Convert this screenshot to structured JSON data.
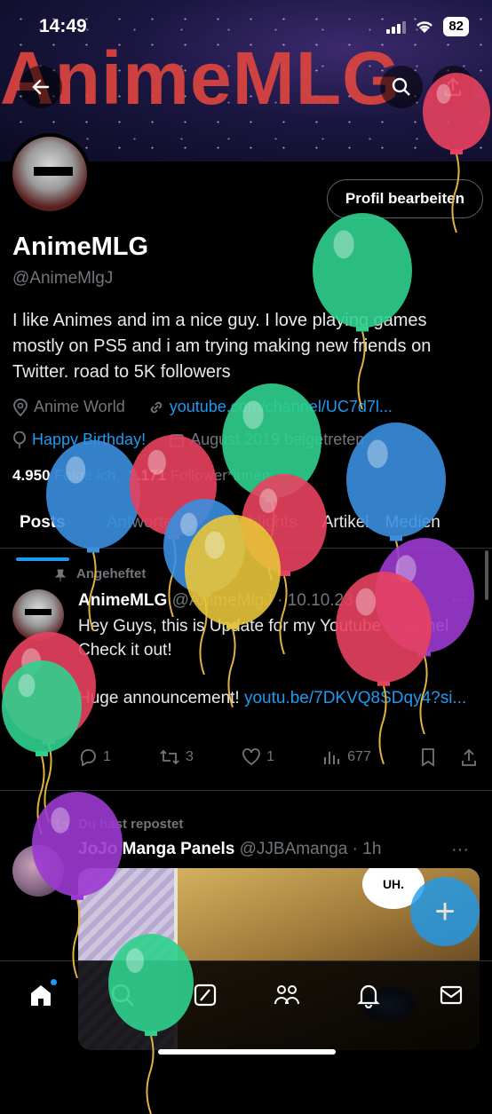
{
  "status_bar": {
    "time": "14:49",
    "battery": "82"
  },
  "banner": {
    "text": "AnimeMLG"
  },
  "profile": {
    "edit_button": "Profil bearbeiten",
    "name": "AnimeMLG",
    "handle": "@AnimeMlgJ",
    "bio": "I like Animes and im a nice guy. I love playing games mostly on PS5 and i am trying making new friends on Twitter. road to 5K followers",
    "location": "Anime World",
    "website": "youtube.com/channel/UC7d7l...",
    "birthday": "Happy Birthday!",
    "joined": "August 2019 beigetreten",
    "following_count": "4.950",
    "following_label": "Folge ich",
    "followers_count": "1.171",
    "followers_label": "Follower*innen"
  },
  "tabs": [
    "Posts",
    "Antworten",
    "Highlights",
    "Artikel",
    "Medien"
  ],
  "pinned_tweet": {
    "pinned_label": "Angeheftet",
    "author": "AnimeMLG",
    "handle": "@AnimeMlgJ",
    "date": "· 10.10.23",
    "text_1": "Hey Guys, this is Update for my Youtube Channel Check it out!",
    "text_2": "Huge announcement! ",
    "link": "youtu.be/7DKVQ8SDqy4?si...",
    "replies": "1",
    "retweets": "3",
    "likes": "1",
    "views": "677"
  },
  "repost": {
    "label": "Du hast repostet",
    "author": "JoJo Manga Panels",
    "handle": "@JJBAmanga",
    "time": "· 1h",
    "bubble_text": "UH."
  },
  "icons": {
    "back": "arrow-left-icon",
    "search": "search-icon",
    "share": "share-icon",
    "home": "home-icon",
    "explore": "search-icon",
    "grok": "grok-icon",
    "communities": "communities-icon",
    "notifications": "bell-icon",
    "messages": "mail-icon"
  },
  "colors": {
    "accent": "#1d9bf0",
    "background": "#000000",
    "muted": "#71767b"
  }
}
